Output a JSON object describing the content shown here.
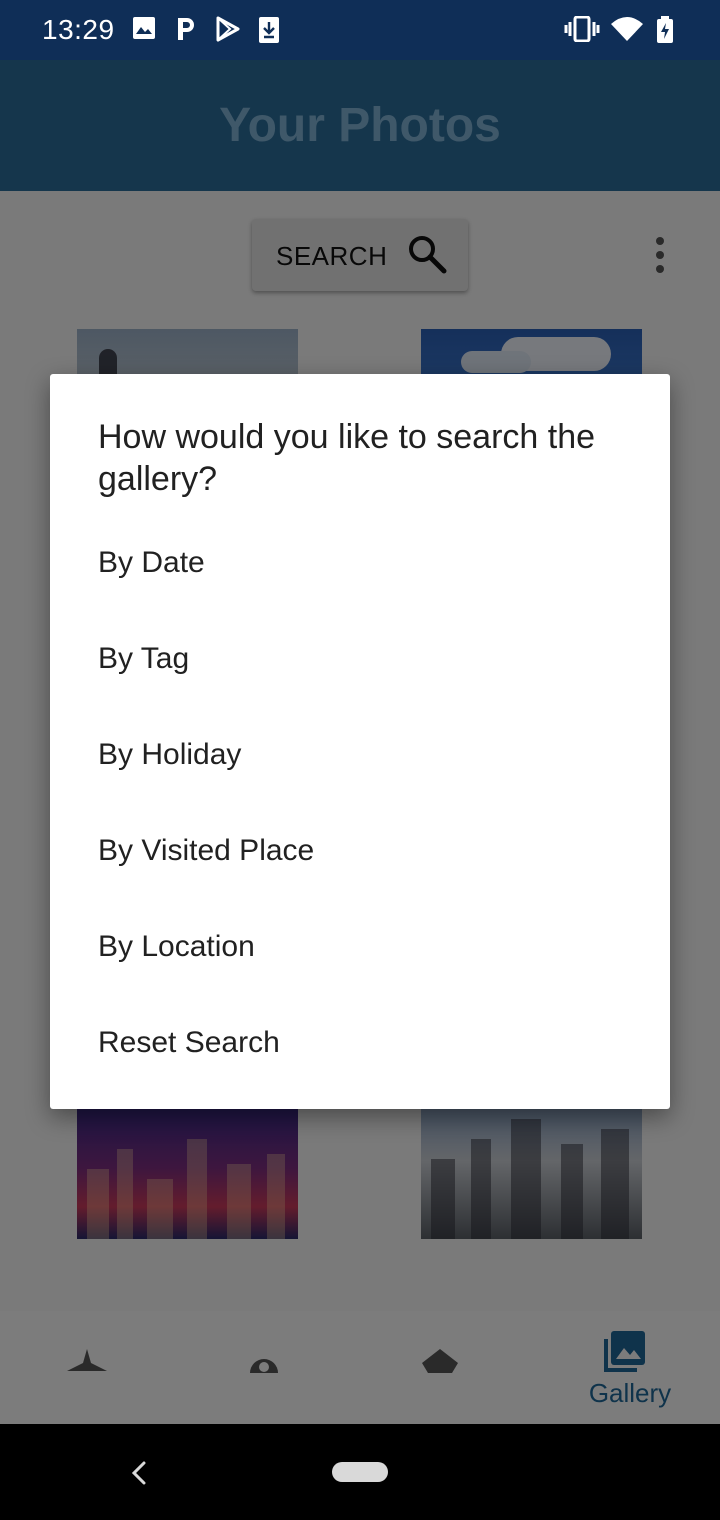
{
  "status_bar": {
    "time": "13:29",
    "left_icons": [
      "image-icon",
      "p-icon",
      "play-store-icon",
      "download-icon"
    ],
    "right_icons": [
      "vibrate-icon",
      "wifi-icon",
      "battery-charging-icon"
    ]
  },
  "app_bar": {
    "title": "Your Photos"
  },
  "toolbar": {
    "search_label": "SEARCH",
    "search_icon": "search-icon",
    "overflow_icon": "more-vert-icon"
  },
  "dialog": {
    "title": "How would you like to search the gallery?",
    "items": [
      {
        "label": "By Date"
      },
      {
        "label": "By Tag"
      },
      {
        "label": "By Holiday"
      },
      {
        "label": "By Visited Place"
      },
      {
        "label": "By Location"
      },
      {
        "label": "Reset Search"
      }
    ]
  },
  "bottom_nav": {
    "items": [
      {
        "icon": "airplane-icon",
        "label": ""
      },
      {
        "icon": "place-icon",
        "label": ""
      },
      {
        "icon": "layers-icon",
        "label": ""
      },
      {
        "icon": "gallery-icon",
        "label": "Gallery",
        "active": true
      }
    ]
  },
  "colors": {
    "status_bar": "#0f2e57",
    "app_bar": "#2b6d99",
    "accent": "#1f6797",
    "dialog_bg": "#ffffff",
    "scrim": "rgba(0,0,0,0.5)"
  }
}
